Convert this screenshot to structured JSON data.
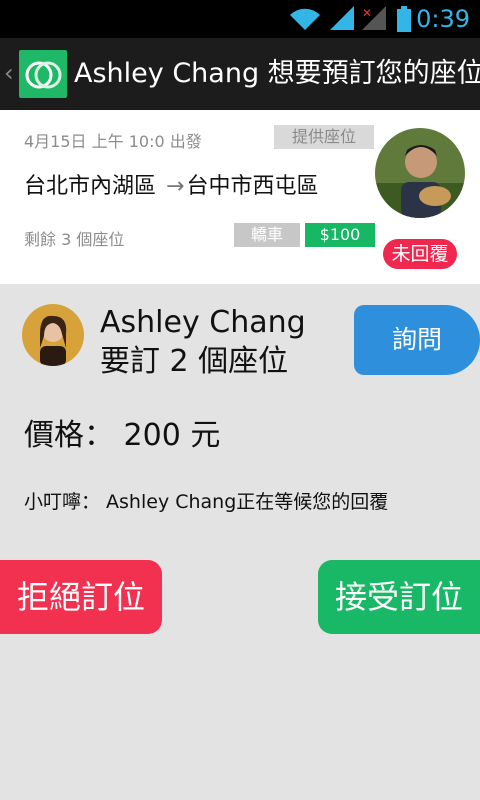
{
  "status_bar": {
    "time": "0:39"
  },
  "action_bar": {
    "title": "Ashley Chang 想要預訂您的座位"
  },
  "trip": {
    "depart_time": "4月15日 上午 10:0 出發",
    "offer_tag": "提供座位",
    "from": "台北市內湖區",
    "to": "台中市西屯區",
    "seats_left": "剩餘 3 個座位",
    "car_tag": "轎車",
    "price_tag": "$100",
    "status_badge": "未回覆"
  },
  "request": {
    "name": "Ashley Chang",
    "seats": "要訂 2 個座位",
    "ask_label": "詢問",
    "price": "價格： 200 元",
    "notice": "小叮嚀： Ashley Chang正在等候您的回覆"
  },
  "actions": {
    "reject_label": "拒絕訂位",
    "accept_label": "接受訂位"
  },
  "colors": {
    "accent_blue": "#2e8fdc",
    "accept_green": "#18b866",
    "reject_red": "#f2304f",
    "status_blue": "#33b5e5"
  }
}
